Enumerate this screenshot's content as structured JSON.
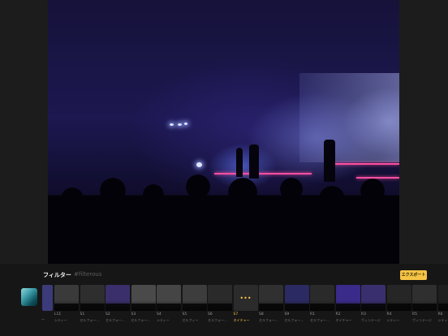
{
  "panel": {
    "title": "フィルター",
    "tag": "#filterous",
    "export_label": "エクスポート"
  },
  "original": {
    "label": "—"
  },
  "filters": [
    {
      "code": "L11",
      "name": "シティー",
      "bg": "#3a3a3a"
    },
    {
      "code": "S1",
      "name": "セルフォー…",
      "bg": "#2e2e2e"
    },
    {
      "code": "S2",
      "name": "セルフォー…",
      "bg": "#3a2f6b"
    },
    {
      "code": "S3",
      "name": "セルフォー…",
      "bg": "#4a4a4a"
    },
    {
      "code": "S4",
      "name": "シティー",
      "bg": "#454545"
    },
    {
      "code": "S5",
      "name": "セルフィー",
      "bg": "#3d3d3d"
    },
    {
      "code": "S6",
      "name": "セルフォー…",
      "bg": "#2a2a2a"
    },
    {
      "code": "S7",
      "name": "ネイチャー",
      "bg": "#2b2b2b",
      "selected": true
    },
    {
      "code": "S8",
      "name": "セルフォー…",
      "bg": "#303030"
    },
    {
      "code": "S9",
      "name": "セルフォー…",
      "bg": "#2c2a63"
    },
    {
      "code": "R1",
      "name": "セルフォー…",
      "bg": "#2a2a2a"
    },
    {
      "code": "R2",
      "name": "ネイチャー",
      "bg": "#3a2a8a"
    },
    {
      "code": "R3",
      "name": "ヴィンテージ",
      "bg": "#3a2f6e"
    },
    {
      "code": "R4",
      "name": "シティー",
      "bg": "#262626"
    },
    {
      "code": "R5",
      "name": "ヴィンテージ",
      "bg": "#2f2f2f"
    },
    {
      "code": "R6",
      "name": "シティー",
      "bg": "#1f1f1f"
    }
  ],
  "selected_icon": "more-dots-icon",
  "accent_color": "#f6c445"
}
